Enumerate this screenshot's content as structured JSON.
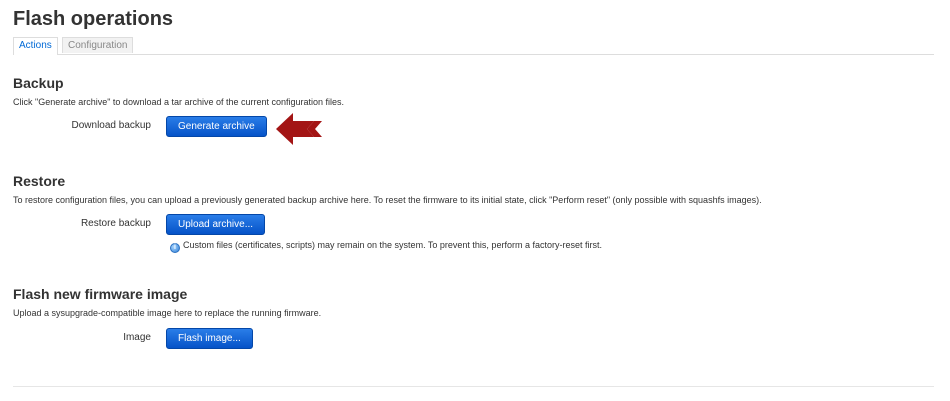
{
  "page": {
    "title": "Flash operations"
  },
  "tabs": [
    {
      "label": "Actions",
      "active": true
    },
    {
      "label": "Configuration",
      "active": false
    }
  ],
  "backup": {
    "title": "Backup",
    "description": "Click \"Generate archive\" to download a tar archive of the current configuration files.",
    "field_label": "Download backup",
    "button_label": "Generate archive"
  },
  "restore": {
    "title": "Restore",
    "description": "To restore configuration files, you can upload a previously generated backup archive here. To reset the firmware to its initial state, click \"Perform reset\" (only possible with squashfs images).",
    "field_label": "Restore backup",
    "button_label": "Upload archive...",
    "hint": "Custom files (certificates, scripts) may remain on the system. To prevent this, perform a factory-reset first.",
    "hint_icon": "info-icon"
  },
  "flash": {
    "title": "Flash new firmware image",
    "description": "Upload a sysupgrade-compatible image here to replace the running firmware.",
    "field_label": "Image",
    "button_label": "Flash image..."
  },
  "colors": {
    "button": "#0553c8",
    "active_tab_text": "#0069d6",
    "annotation_arrow": "#a31515"
  }
}
